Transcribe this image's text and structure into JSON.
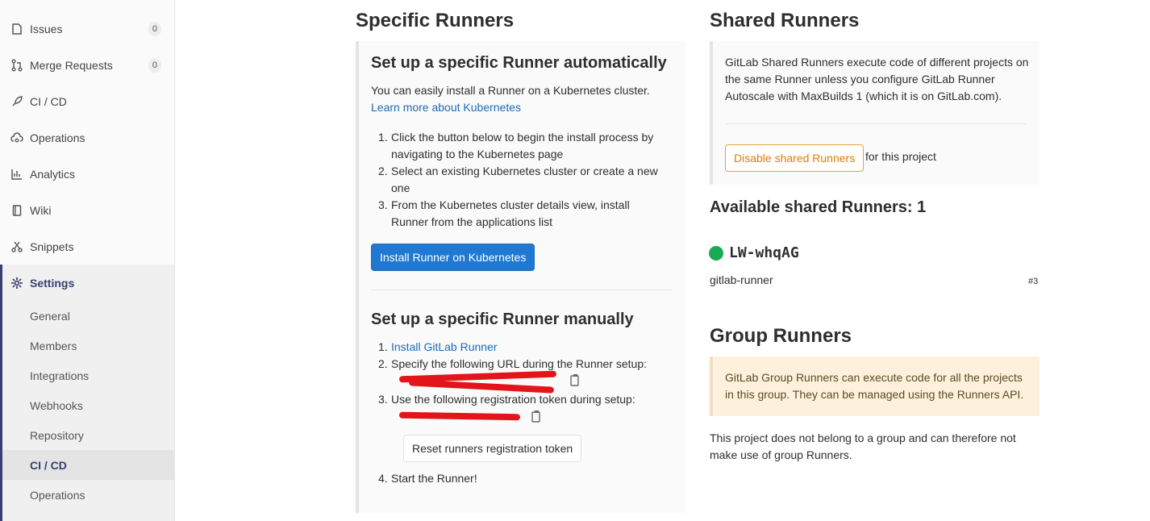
{
  "sidebar": {
    "items": [
      {
        "label": "Issues",
        "icon": "issues-icon",
        "count": "0"
      },
      {
        "label": "Merge Requests",
        "icon": "merge-request-icon",
        "count": "0"
      },
      {
        "label": "CI / CD",
        "icon": "rocket-icon"
      },
      {
        "label": "Operations",
        "icon": "cloud-gear-icon"
      },
      {
        "label": "Analytics",
        "icon": "chart-icon"
      },
      {
        "label": "Wiki",
        "icon": "book-icon"
      },
      {
        "label": "Snippets",
        "icon": "scissors-icon"
      },
      {
        "label": "Settings",
        "icon": "gear-icon"
      }
    ],
    "settings_sub": [
      "General",
      "Members",
      "Integrations",
      "Webhooks",
      "Repository",
      "CI / CD",
      "Operations"
    ],
    "active_sub": "CI / CD"
  },
  "specific": {
    "title": "Specific Runners",
    "auto": {
      "title": "Set up a specific Runner automatically",
      "intro": "You can easily install a Runner on a Kubernetes cluster.",
      "learn_link": "Learn more about Kubernetes",
      "steps": [
        "Click the button below to begin the install process by navigating to the Kubernetes page",
        "Select an existing Kubernetes cluster or create a new one",
        "From the Kubernetes cluster details view, install Runner from the applications list"
      ],
      "install_button": "Install Runner on Kubernetes"
    },
    "manual": {
      "title": "Set up a specific Runner manually",
      "step1_link": "Install GitLab Runner",
      "step2": "Specify the following URL during the Runner setup:",
      "step3": "Use the following registration token during setup:",
      "reset_button": "Reset runners registration token",
      "step4": "Start the Runner!"
    }
  },
  "shared": {
    "title": "Shared Runners",
    "description": "GitLab Shared Runners execute code of different projects on the same Runner unless you configure GitLab Runner Autoscale with MaxBuilds 1 (which it is on GitLab.com).",
    "disable_button": "Disable shared Runners",
    "for_project": "for this project",
    "available_title": "Available shared Runners: 1",
    "runner": {
      "name": "LW-whqAG",
      "description": "gitlab-runner",
      "id": "#3",
      "status_color": "#1aaa55"
    }
  },
  "group": {
    "title": "Group Runners",
    "description": "GitLab Group Runners can execute code for all the projects in this group. They can be managed using the Runners API.",
    "note": "This project does not belong to a group and can therefore not make use of group Runners."
  },
  "colors": {
    "primary": "#1f78d1",
    "warning": "#de7e00",
    "link": "#1f6bb5",
    "settings_accent": "#3a3f73"
  }
}
